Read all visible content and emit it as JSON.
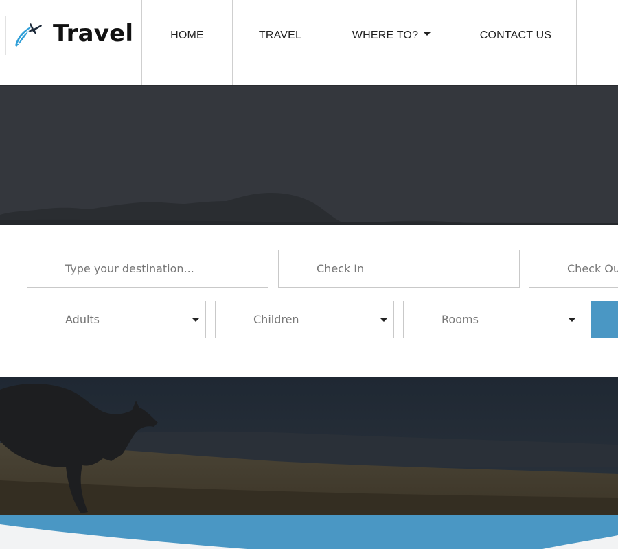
{
  "brand": {
    "name": "Travel",
    "logo_icon": "airplane-logo-icon"
  },
  "nav": {
    "items": [
      {
        "label": "HOME",
        "has_dropdown": false
      },
      {
        "label": "TRAVEL",
        "has_dropdown": false
      },
      {
        "label": "WHERE TO?",
        "has_dropdown": true
      },
      {
        "label": "CONTACT US",
        "has_dropdown": false
      }
    ]
  },
  "search": {
    "destination_placeholder": "Type your destination...",
    "checkin_placeholder": "Check In",
    "checkout_placeholder": "Check Out",
    "adults_placeholder": "Adults",
    "children_placeholder": "Children",
    "rooms_placeholder": "Rooms"
  },
  "colors": {
    "accent": "#4a97c4",
    "hero_dark": "#34373d",
    "text": "#222222",
    "placeholder": "#777777"
  }
}
